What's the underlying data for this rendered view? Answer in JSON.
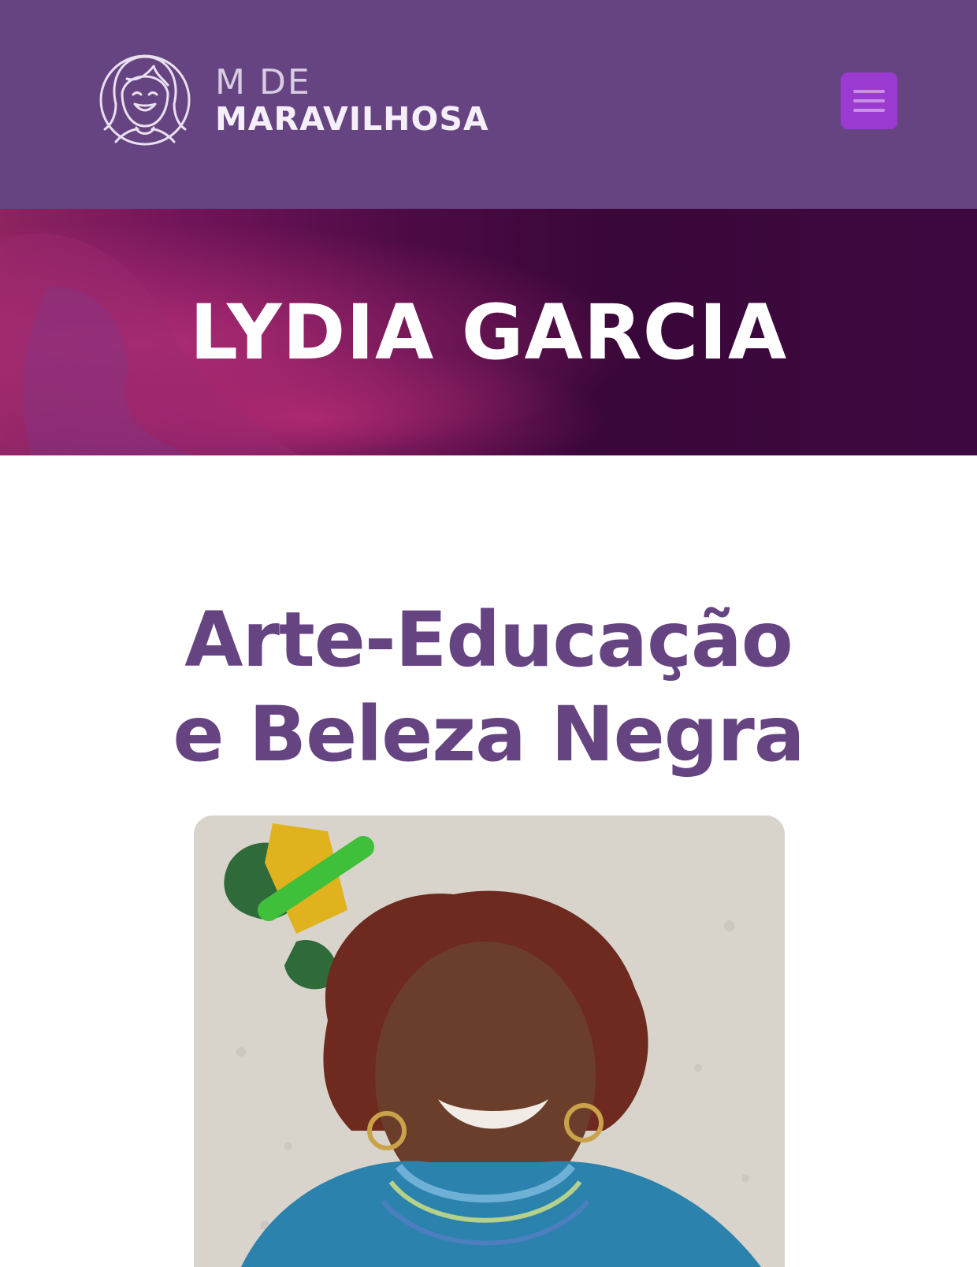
{
  "header": {
    "logo_line1": "M DE",
    "logo_line2": "MARAVILHOSA",
    "menu_icon": "hamburger-menu-icon",
    "colors": {
      "background": "#664482",
      "menu_button": "#9a3ad0"
    }
  },
  "hero": {
    "title": "LYDIA GARCIA",
    "colors": {
      "background_dark": "#3a0739",
      "background_accent": "#8e2360"
    }
  },
  "article": {
    "title": "Arte-Educação e Beleza Negra",
    "title_color": "#664482"
  },
  "photo": {
    "icon": "portrait-photo"
  }
}
